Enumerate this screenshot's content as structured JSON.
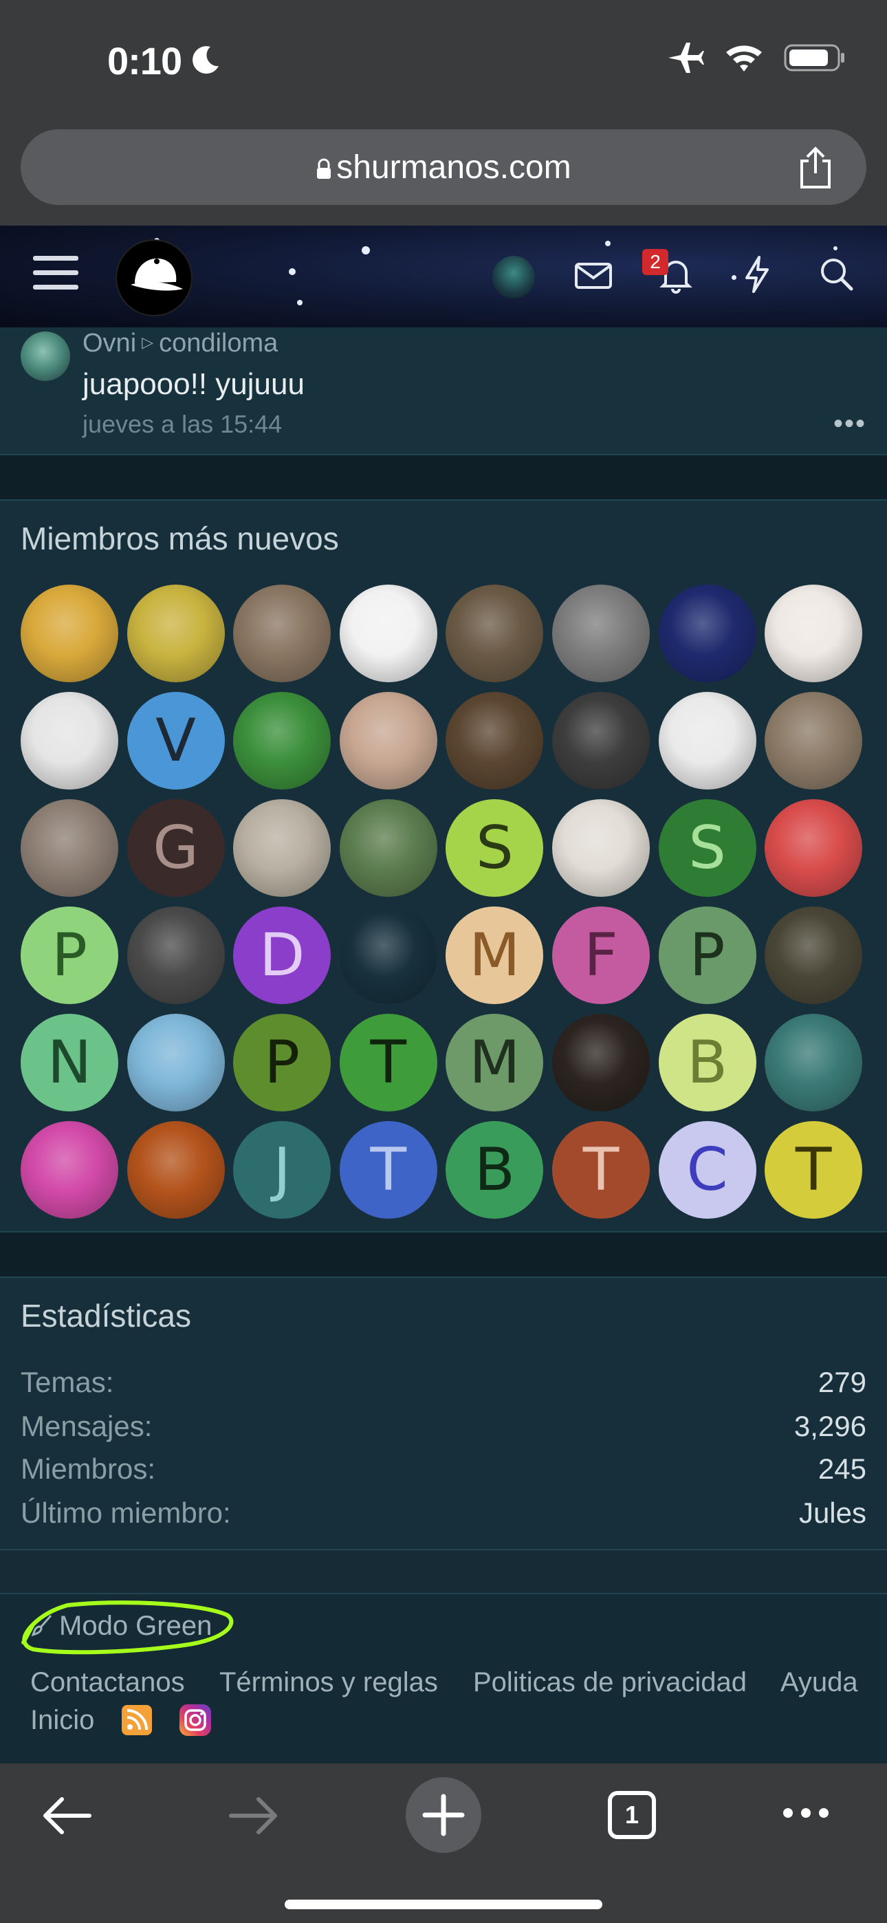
{
  "status_bar": {
    "time": "0:10"
  },
  "browser": {
    "url": "shurmanos.com"
  },
  "header": {
    "notification_count": "2"
  },
  "activity": {
    "user": "Ovni",
    "target": "condiloma",
    "text": "juapooo!! yujuuu",
    "time": "jueves a las 15:44",
    "more": "•••"
  },
  "members": {
    "title": "Miembros más nuevos",
    "avatars": [
      {
        "letter": "",
        "bg": "#d9a93b"
      },
      {
        "letter": "",
        "bg": "#c9b340"
      },
      {
        "letter": "",
        "bg": "#8a7662"
      },
      {
        "letter": "",
        "bg": "#f2f2f2"
      },
      {
        "letter": "",
        "bg": "#6a5a45"
      },
      {
        "letter": "",
        "bg": "#7d7d7d"
      },
      {
        "letter": "",
        "bg": "#1e2a6e"
      },
      {
        "letter": "",
        "bg": "#efe9e4"
      },
      {
        "letter": "",
        "bg": "#e5e5e5"
      },
      {
        "letter": "V",
        "bg": "#4a96d6",
        "fg": "#1d2a36"
      },
      {
        "letter": "",
        "bg": "#3b8f3b"
      },
      {
        "letter": "",
        "bg": "#c7a792"
      },
      {
        "letter": "",
        "bg": "#5b4631"
      },
      {
        "letter": "",
        "bg": "#3d3d3d"
      },
      {
        "letter": "",
        "bg": "#eaeaea"
      },
      {
        "letter": "",
        "bg": "#8c7b67"
      },
      {
        "letter": "",
        "bg": "#8d7f74"
      },
      {
        "letter": "G",
        "bg": "#3b2a2a",
        "fg": "#a88f8a"
      },
      {
        "letter": "",
        "bg": "#b8b0a2"
      },
      {
        "letter": "",
        "bg": "#5b7d4f"
      },
      {
        "letter": "S",
        "bg": "#a5d34a",
        "fg": "#2a3a14"
      },
      {
        "letter": "",
        "bg": "#e2ddd6"
      },
      {
        "letter": "S",
        "bg": "#2f7d34",
        "fg": "#a6e09a"
      },
      {
        "letter": "",
        "bg": "#d94c4c"
      },
      {
        "letter": "P",
        "bg": "#8fd47d",
        "fg": "#2a5a26"
      },
      {
        "letter": "",
        "bg": "#4a4a4a"
      },
      {
        "letter": "D",
        "bg": "#8a3ec9",
        "fg": "#e3cdf5"
      },
      {
        "letter": "",
        "bg": "#17313d"
      },
      {
        "letter": "M",
        "bg": "#e7c69a",
        "fg": "#8a5a28"
      },
      {
        "letter": "F",
        "bg": "#c45a9f",
        "fg": "#5a2346"
      },
      {
        "letter": "P",
        "bg": "#6a9a6a",
        "fg": "#1d321d"
      },
      {
        "letter": "",
        "bg": "#4a4637"
      },
      {
        "letter": "N",
        "bg": "#6cc38a",
        "fg": "#1d4a2c"
      },
      {
        "letter": "",
        "bg": "#7fb7d9"
      },
      {
        "letter": "P",
        "bg": "#5e8d2e",
        "fg": "#142108"
      },
      {
        "letter": "T",
        "bg": "#3f9c3a",
        "fg": "#0e240c"
      },
      {
        "letter": "M",
        "bg": "#6e9a6a",
        "fg": "#1f301e"
      },
      {
        "letter": "",
        "bg": "#2b2420"
      },
      {
        "letter": "B",
        "bg": "#cfe487",
        "fg": "#6c7d34"
      },
      {
        "letter": "",
        "bg": "#3a7a76"
      },
      {
        "letter": "",
        "bg": "#d24aa8"
      },
      {
        "letter": "",
        "bg": "#b3531c"
      },
      {
        "letter": "J",
        "bg": "#2d6d6e",
        "fg": "#8fd1d2"
      },
      {
        "letter": "T",
        "bg": "#3f64c8",
        "fg": "#b9c8f0"
      },
      {
        "letter": "B",
        "bg": "#3a9c5a",
        "fg": "#0e2a16"
      },
      {
        "letter": "T",
        "bg": "#a44a2c",
        "fg": "#e9c2b2"
      },
      {
        "letter": "C",
        "bg": "#c9c9f0",
        "fg": "#3d3dbd"
      },
      {
        "letter": "T",
        "bg": "#d4cc3b",
        "fg": "#3b3608"
      }
    ]
  },
  "stats": {
    "title": "Estadísticas",
    "rows": [
      {
        "label": "Temas:",
        "value": "279"
      },
      {
        "label": "Mensajes:",
        "value": "3,296"
      },
      {
        "label": "Miembros:",
        "value": "245"
      },
      {
        "label": "Último miembro:",
        "value": "Jules"
      }
    ]
  },
  "footer": {
    "style_toggle": "Modo Green",
    "links": [
      "Contactanos",
      "Términos y reglas",
      "Politicas de privacidad",
      "Ayuda"
    ],
    "home": "Inicio",
    "highlight_color": "#a6ff1a"
  },
  "toolbar": {
    "tab_count": "1"
  }
}
